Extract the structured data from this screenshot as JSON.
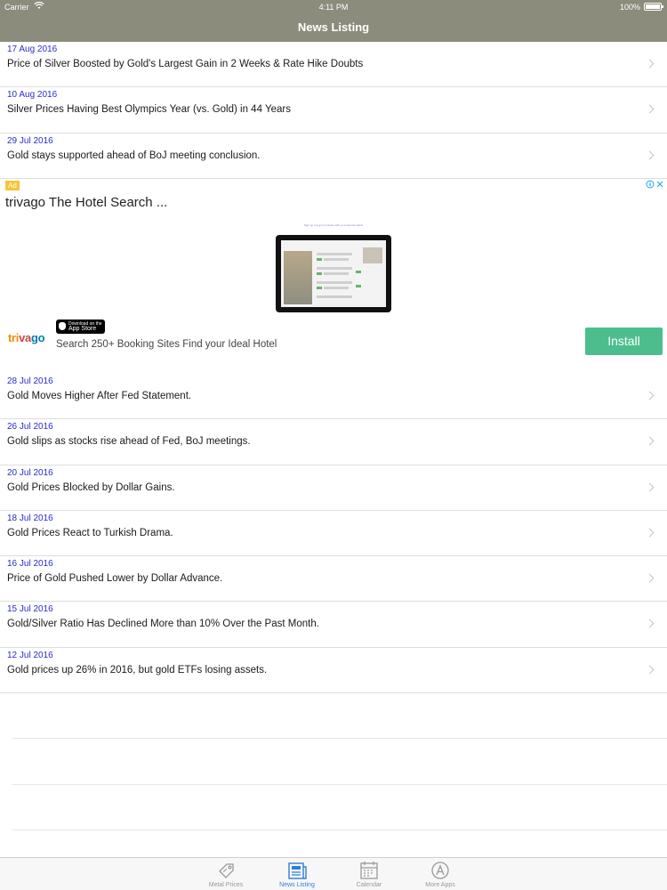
{
  "status_bar": {
    "carrier": "Carrier",
    "time": "4:11 PM",
    "battery": "100%"
  },
  "nav": {
    "title": "News Listing"
  },
  "news_items_top": [
    {
      "date": "17 Aug 2016",
      "headline": "Price of Silver Boosted by Gold's Largest Gain in 2 Weeks & Rate Hike Doubts"
    },
    {
      "date": "10 Aug 2016",
      "headline": "Silver Prices Having Best Olympics Year (vs. Gold) in 44 Years"
    },
    {
      "date": "29 Jul 2016",
      "headline": "Gold stays supported ahead of BoJ meeting conclusion."
    }
  ],
  "ad": {
    "badge": "Ad",
    "title": "trivago The Hotel Search ...",
    "caption": "Sign up or log in to Genie with your favorite hotels",
    "logo": {
      "t1": "tri",
      "t2": "va",
      "t3": "go"
    },
    "appstore_small": "Download on the",
    "appstore_big": "App Store",
    "description": "Search 250+ Booking Sites Find your Ideal Hotel",
    "install_label": "Install"
  },
  "news_items_bottom": [
    {
      "date": "28 Jul 2016",
      "headline": "Gold Moves Higher After Fed Statement."
    },
    {
      "date": "26 Jul 2016",
      "headline": "Gold slips as stocks rise ahead of Fed, BoJ meetings."
    },
    {
      "date": "20 Jul 2016",
      "headline": "Gold Prices Blocked by Dollar Gains."
    },
    {
      "date": "18 Jul 2016",
      "headline": "Gold Prices React to Turkish Drama."
    },
    {
      "date": "16 Jul 2016",
      "headline": "Price of Gold Pushed Lower by Dollar Advance."
    },
    {
      "date": "15 Jul 2016",
      "headline": "Gold/Silver Ratio Has Declined More than 10% Over the Past Month."
    },
    {
      "date": "12 Jul 2016",
      "headline": "Gold prices up 26% in 2016, but gold ETFs losing assets."
    }
  ],
  "tabs": [
    {
      "label": "Metal Prices",
      "icon": "price-tag-icon"
    },
    {
      "label": "News Listing",
      "icon": "newspaper-icon"
    },
    {
      "label": "Calendar",
      "icon": "calendar-icon"
    },
    {
      "label": "More Apps",
      "icon": "app-store-icon"
    }
  ],
  "colors": {
    "header_bg": "#8c8c7d",
    "date_text": "#2a2ad0",
    "install_button": "#4cbe8d",
    "tab_active": "#2e7fd7",
    "tab_inactive": "#999999"
  }
}
